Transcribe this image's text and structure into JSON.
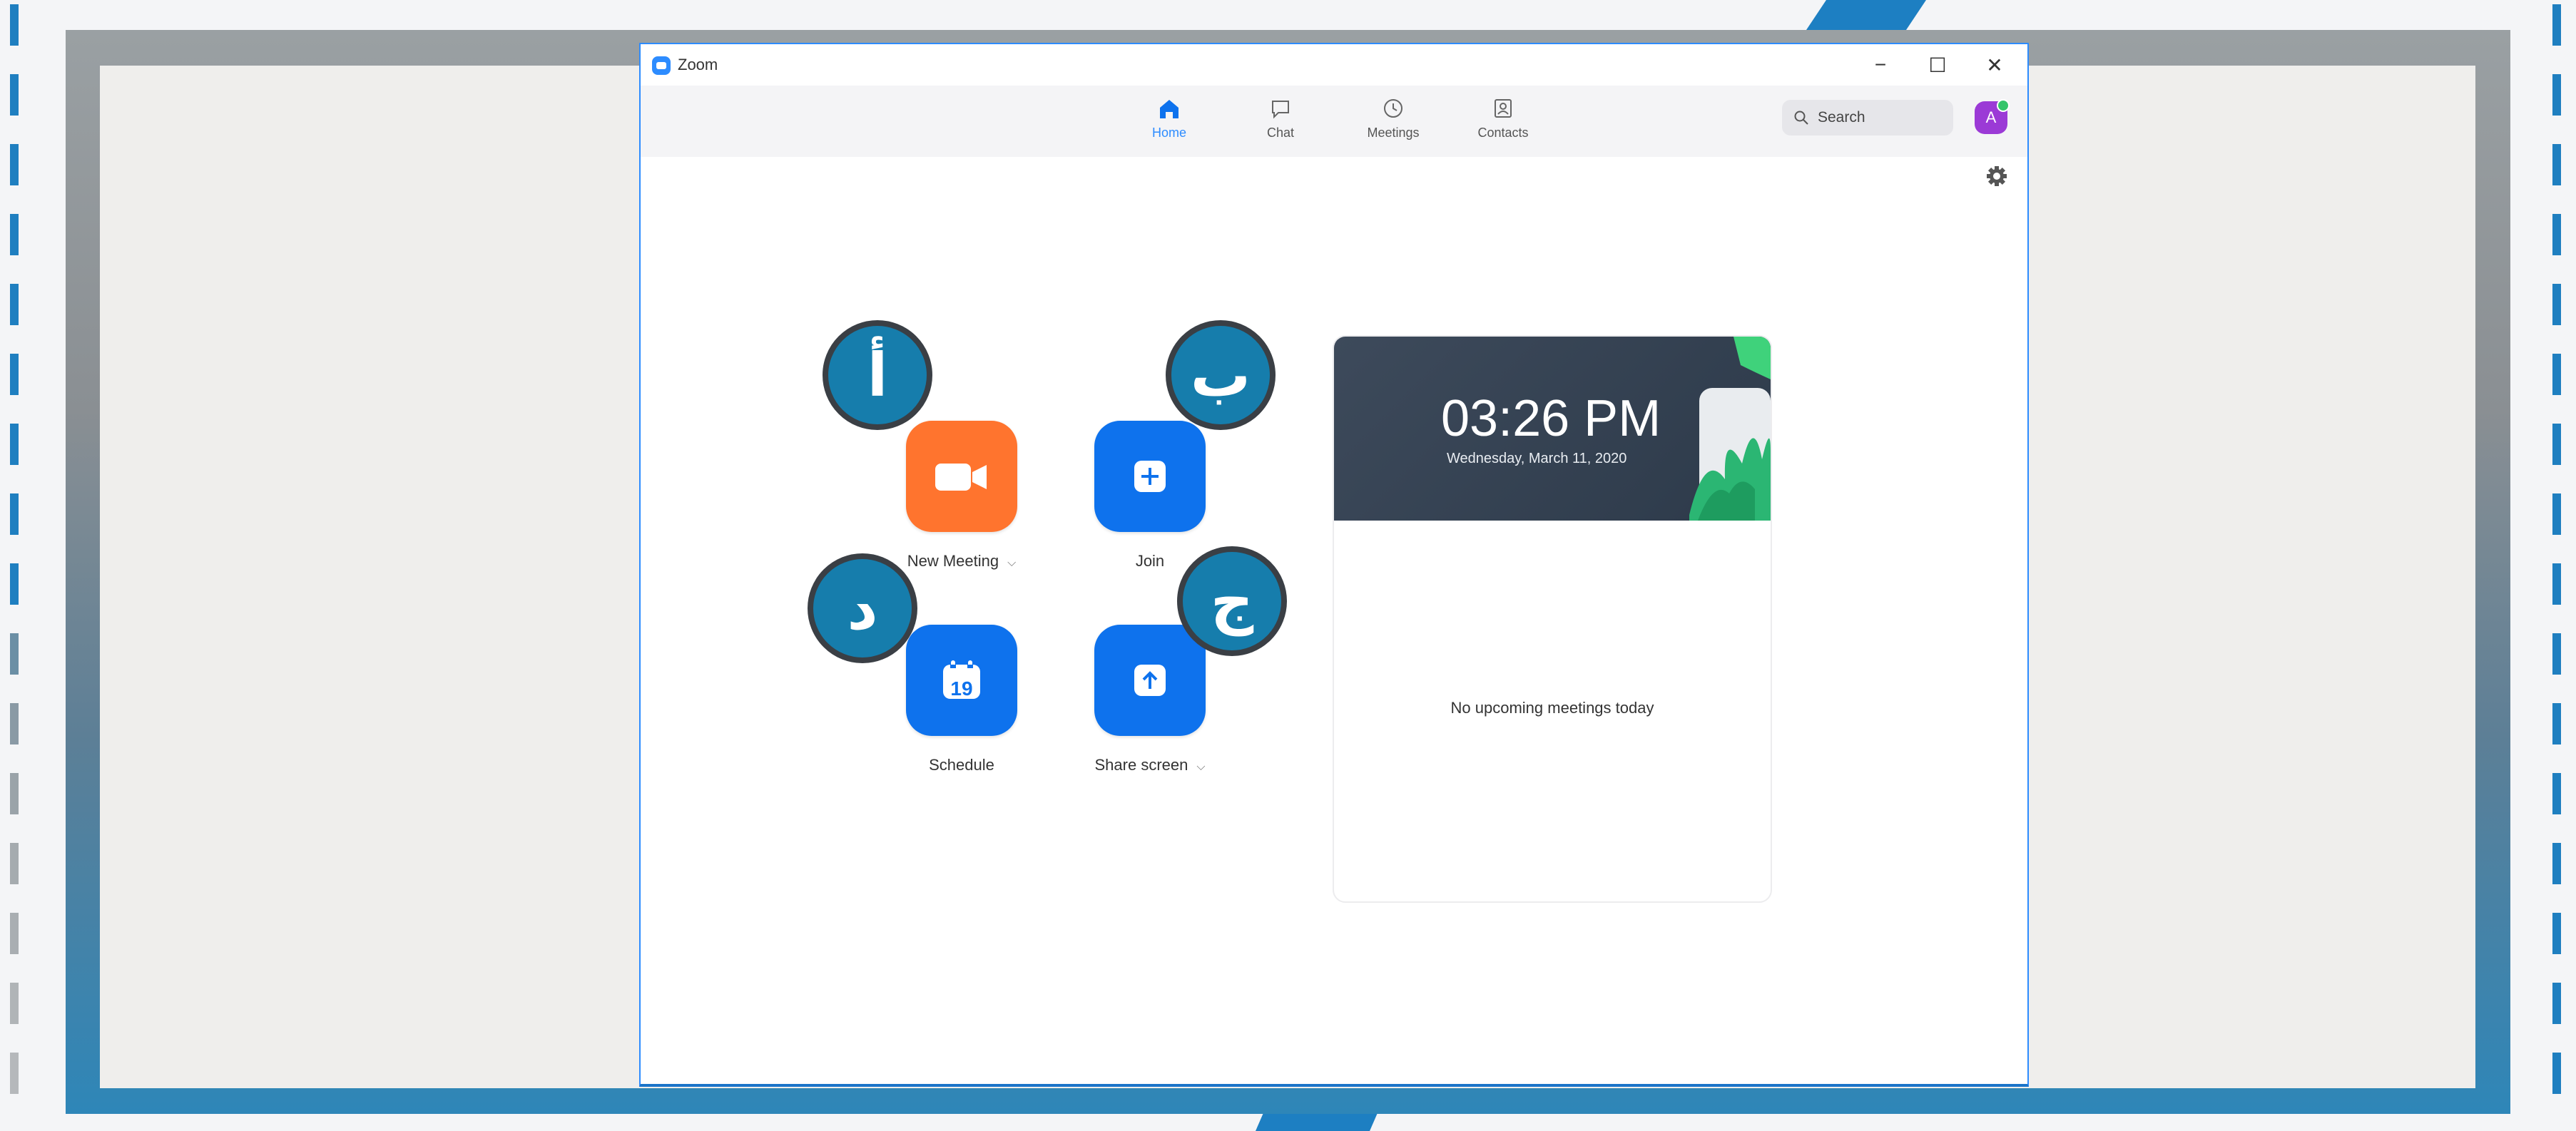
{
  "window": {
    "title": "Zoom",
    "controls": {
      "minimize": "−",
      "maximize": "☐",
      "close": "✕"
    }
  },
  "nav": {
    "tabs": [
      {
        "label": "Home",
        "icon": "home-icon",
        "active": true
      },
      {
        "label": "Chat",
        "icon": "chat-icon",
        "active": false
      },
      {
        "label": "Meetings",
        "icon": "clock-icon",
        "active": false
      },
      {
        "label": "Contacts",
        "icon": "contacts-icon",
        "active": false
      }
    ],
    "search": {
      "placeholder": "Search"
    },
    "avatar": {
      "initial": "A",
      "status_color": "#35c46a"
    }
  },
  "actions": {
    "new_meeting": {
      "label": "New Meeting",
      "color": "#ff742e",
      "icon": "video-camera-icon"
    },
    "join": {
      "label": "Join",
      "color": "#0e72ed",
      "icon": "plus-icon"
    },
    "schedule": {
      "label": "Schedule",
      "color": "#0e72ed",
      "icon": "calendar-icon",
      "calendar_day": "19"
    },
    "share_screen": {
      "label": "Share screen",
      "color": "#0e72ed",
      "icon": "share-up-arrow-icon"
    }
  },
  "annotations": {
    "a": "أ",
    "b": "ب",
    "c": "ج",
    "d": "د"
  },
  "meeting_card": {
    "time": "03:26 PM",
    "date": "Wednesday, March 11, 2020",
    "empty_message": "No upcoming meetings today"
  },
  "colors": {
    "accent": "#2d8cff",
    "badge": "#167dac",
    "frame_bottom": "#2e86b8"
  }
}
